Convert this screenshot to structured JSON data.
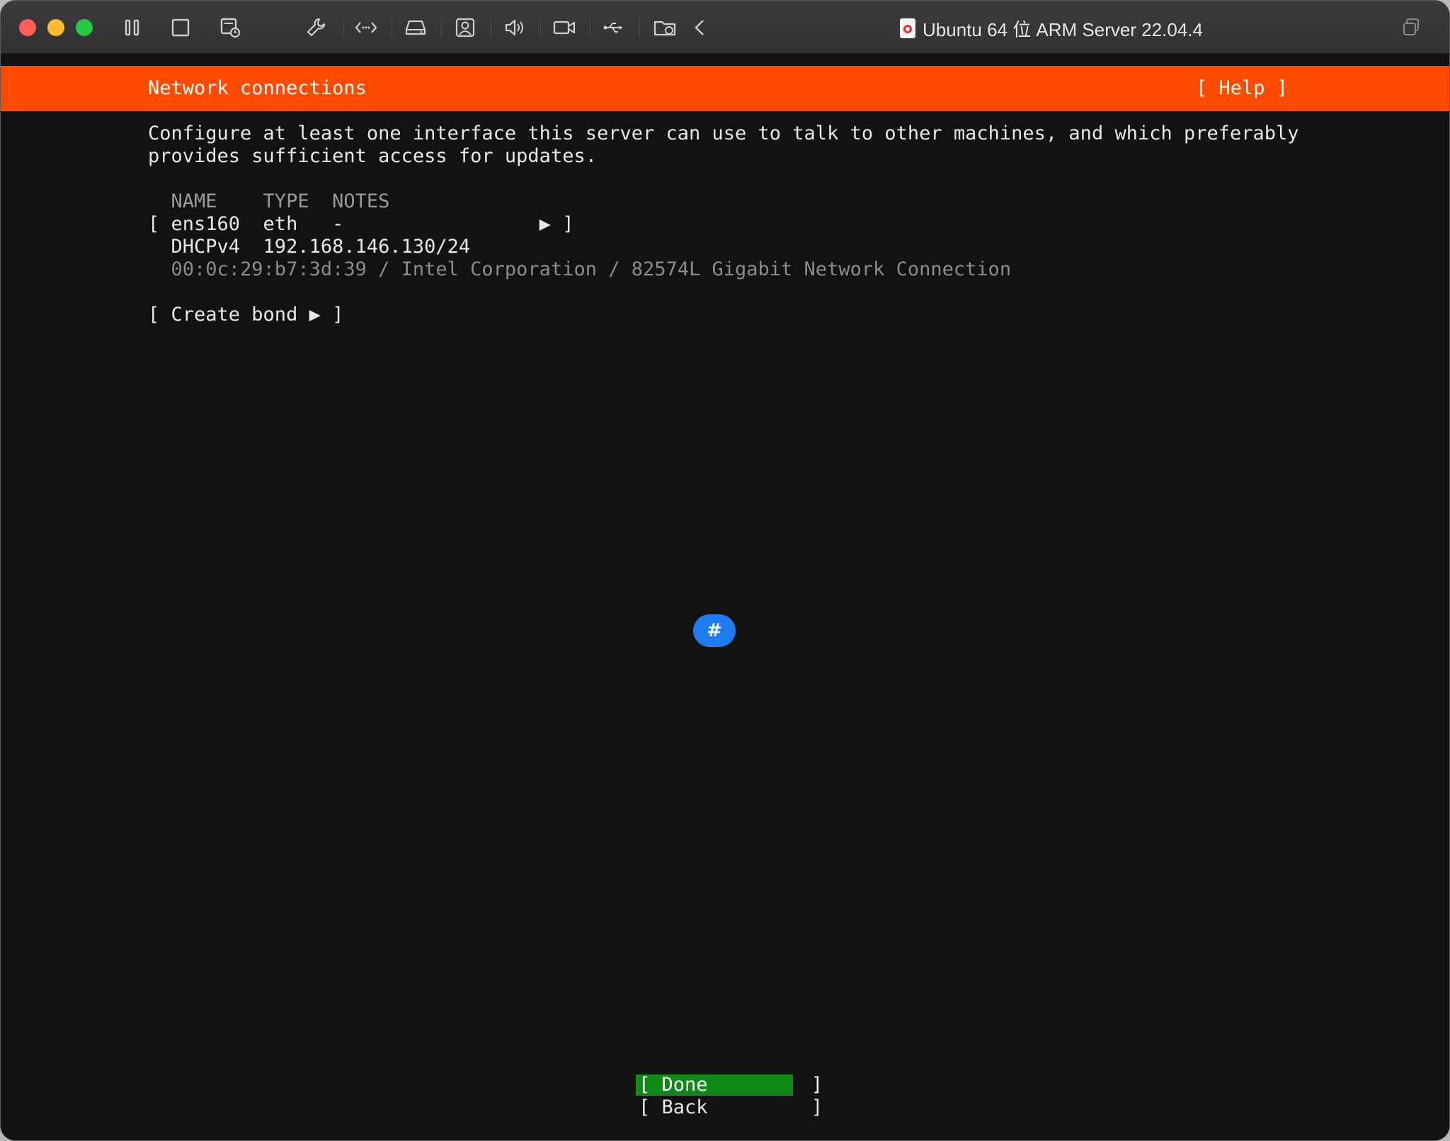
{
  "window": {
    "title": "Ubuntu 64 位 ARM Server 22.04.4"
  },
  "toolbar": {
    "icons": [
      "pause-icon",
      "stop-square-icon",
      "snapshot-icon",
      "wrench-icon",
      "code-arrows-icon",
      "drive-icon",
      "user-icon",
      "speaker-icon",
      "camera-icon",
      "usb-icon",
      "shared-folder-icon",
      "chevron-left-icon"
    ],
    "right_icon": "window-copy-icon"
  },
  "header": {
    "title": "Network connections",
    "help": "[ Help ]"
  },
  "intro": {
    "line1": "Configure at least one interface this server can use to talk to other machines, and which preferably",
    "line2": "provides sufficient access for updates."
  },
  "table": {
    "columns_line": "  NAME    TYPE  NOTES",
    "interface_row": "[ ens160  eth   -                 ▶ ]",
    "dhcp_row": "  DHCPv4  192.168.146.130/24",
    "hw_row": "  00:0c:29:b7:3d:39 / Intel Corporation / 82574L Gigabit Network Connection"
  },
  "create_bond": "[ Create bond ▶ ]",
  "buttons": {
    "done": "[ Done         ]",
    "back": "[ Back         ]"
  },
  "float_button": {
    "label": "#"
  },
  "colors": {
    "header_bg": "#ff4a00",
    "selected_button_bg": "#0e8a16",
    "float_button_bg": "#1f7cf0",
    "terminal_bg": "#121212"
  }
}
